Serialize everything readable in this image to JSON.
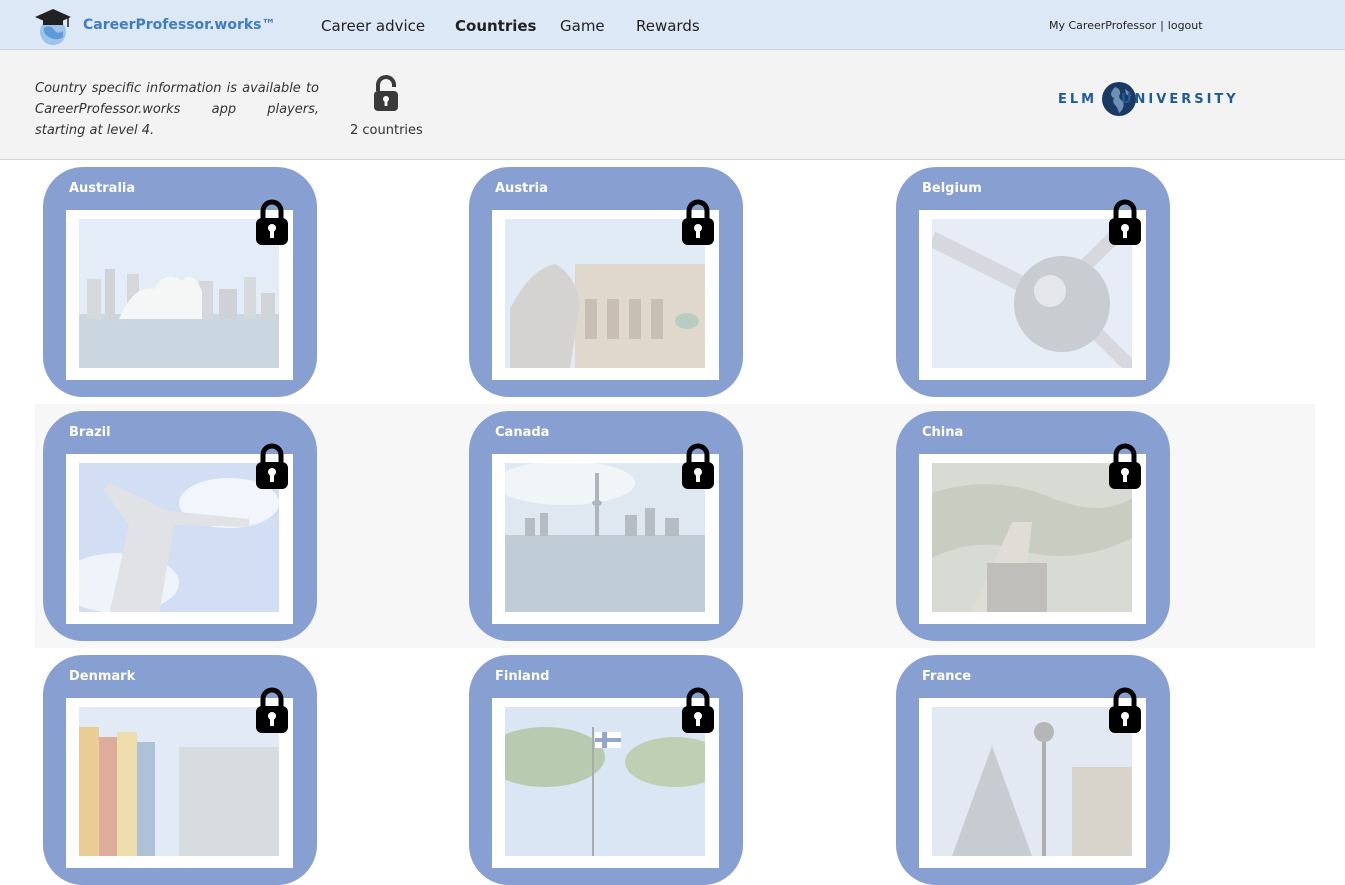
{
  "header": {
    "logo_text": "CareerProfessor.works™",
    "nav": [
      {
        "label": "Career advice",
        "active": false
      },
      {
        "label": "Countries",
        "active": true
      },
      {
        "label": "Game",
        "active": false
      },
      {
        "label": "Rewards",
        "active": false
      }
    ],
    "user_link": "My CareerProfessor",
    "separator": "|",
    "logout_link": "logout"
  },
  "info": {
    "text": "Country specific information is available to CareerProfessor.works app players, starting at level 4.",
    "unlock_count": "2 countries",
    "partner_left": "ELM",
    "partner_right": "UNIVERSITY"
  },
  "colors": {
    "nav_bg": "#dce8f6",
    "card_bg": "#879fd1",
    "logo_text": "#3f7cc0",
    "partner_text": "#1f5c9a"
  },
  "countries": [
    {
      "name": "Australia",
      "locked": true
    },
    {
      "name": "Austria",
      "locked": true
    },
    {
      "name": "Belgium",
      "locked": true
    },
    {
      "name": "Brazil",
      "locked": true
    },
    {
      "name": "Canada",
      "locked": true
    },
    {
      "name": "China",
      "locked": true
    },
    {
      "name": "Denmark",
      "locked": true
    },
    {
      "name": "Finland",
      "locked": true
    },
    {
      "name": "France",
      "locked": true
    }
  ]
}
